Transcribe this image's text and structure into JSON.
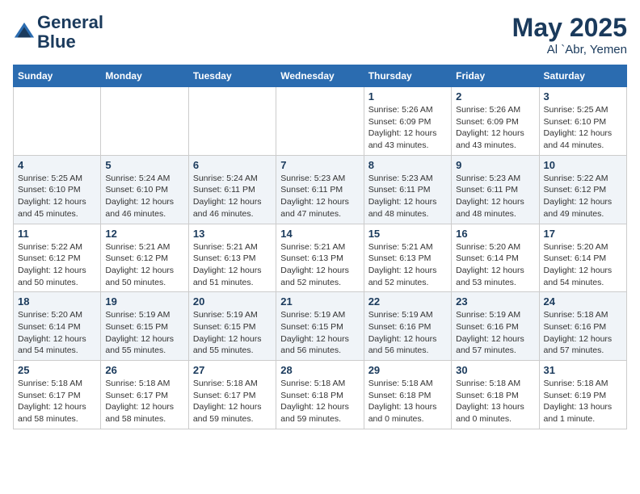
{
  "header": {
    "logo_line1": "General",
    "logo_line2": "Blue",
    "month_year": "May 2025",
    "location": "Al `Abr, Yemen"
  },
  "days_of_week": [
    "Sunday",
    "Monday",
    "Tuesday",
    "Wednesday",
    "Thursday",
    "Friday",
    "Saturday"
  ],
  "weeks": [
    [
      {
        "day": "",
        "info": ""
      },
      {
        "day": "",
        "info": ""
      },
      {
        "day": "",
        "info": ""
      },
      {
        "day": "",
        "info": ""
      },
      {
        "day": "1",
        "info": "Sunrise: 5:26 AM\nSunset: 6:09 PM\nDaylight: 12 hours\nand 43 minutes."
      },
      {
        "day": "2",
        "info": "Sunrise: 5:26 AM\nSunset: 6:09 PM\nDaylight: 12 hours\nand 43 minutes."
      },
      {
        "day": "3",
        "info": "Sunrise: 5:25 AM\nSunset: 6:10 PM\nDaylight: 12 hours\nand 44 minutes."
      }
    ],
    [
      {
        "day": "4",
        "info": "Sunrise: 5:25 AM\nSunset: 6:10 PM\nDaylight: 12 hours\nand 45 minutes."
      },
      {
        "day": "5",
        "info": "Sunrise: 5:24 AM\nSunset: 6:10 PM\nDaylight: 12 hours\nand 46 minutes."
      },
      {
        "day": "6",
        "info": "Sunrise: 5:24 AM\nSunset: 6:11 PM\nDaylight: 12 hours\nand 46 minutes."
      },
      {
        "day": "7",
        "info": "Sunrise: 5:23 AM\nSunset: 6:11 PM\nDaylight: 12 hours\nand 47 minutes."
      },
      {
        "day": "8",
        "info": "Sunrise: 5:23 AM\nSunset: 6:11 PM\nDaylight: 12 hours\nand 48 minutes."
      },
      {
        "day": "9",
        "info": "Sunrise: 5:23 AM\nSunset: 6:11 PM\nDaylight: 12 hours\nand 48 minutes."
      },
      {
        "day": "10",
        "info": "Sunrise: 5:22 AM\nSunset: 6:12 PM\nDaylight: 12 hours\nand 49 minutes."
      }
    ],
    [
      {
        "day": "11",
        "info": "Sunrise: 5:22 AM\nSunset: 6:12 PM\nDaylight: 12 hours\nand 50 minutes."
      },
      {
        "day": "12",
        "info": "Sunrise: 5:21 AM\nSunset: 6:12 PM\nDaylight: 12 hours\nand 50 minutes."
      },
      {
        "day": "13",
        "info": "Sunrise: 5:21 AM\nSunset: 6:13 PM\nDaylight: 12 hours\nand 51 minutes."
      },
      {
        "day": "14",
        "info": "Sunrise: 5:21 AM\nSunset: 6:13 PM\nDaylight: 12 hours\nand 52 minutes."
      },
      {
        "day": "15",
        "info": "Sunrise: 5:21 AM\nSunset: 6:13 PM\nDaylight: 12 hours\nand 52 minutes."
      },
      {
        "day": "16",
        "info": "Sunrise: 5:20 AM\nSunset: 6:14 PM\nDaylight: 12 hours\nand 53 minutes."
      },
      {
        "day": "17",
        "info": "Sunrise: 5:20 AM\nSunset: 6:14 PM\nDaylight: 12 hours\nand 54 minutes."
      }
    ],
    [
      {
        "day": "18",
        "info": "Sunrise: 5:20 AM\nSunset: 6:14 PM\nDaylight: 12 hours\nand 54 minutes."
      },
      {
        "day": "19",
        "info": "Sunrise: 5:19 AM\nSunset: 6:15 PM\nDaylight: 12 hours\nand 55 minutes."
      },
      {
        "day": "20",
        "info": "Sunrise: 5:19 AM\nSunset: 6:15 PM\nDaylight: 12 hours\nand 55 minutes."
      },
      {
        "day": "21",
        "info": "Sunrise: 5:19 AM\nSunset: 6:15 PM\nDaylight: 12 hours\nand 56 minutes."
      },
      {
        "day": "22",
        "info": "Sunrise: 5:19 AM\nSunset: 6:16 PM\nDaylight: 12 hours\nand 56 minutes."
      },
      {
        "day": "23",
        "info": "Sunrise: 5:19 AM\nSunset: 6:16 PM\nDaylight: 12 hours\nand 57 minutes."
      },
      {
        "day": "24",
        "info": "Sunrise: 5:18 AM\nSunset: 6:16 PM\nDaylight: 12 hours\nand 57 minutes."
      }
    ],
    [
      {
        "day": "25",
        "info": "Sunrise: 5:18 AM\nSunset: 6:17 PM\nDaylight: 12 hours\nand 58 minutes."
      },
      {
        "day": "26",
        "info": "Sunrise: 5:18 AM\nSunset: 6:17 PM\nDaylight: 12 hours\nand 58 minutes."
      },
      {
        "day": "27",
        "info": "Sunrise: 5:18 AM\nSunset: 6:17 PM\nDaylight: 12 hours\nand 59 minutes."
      },
      {
        "day": "28",
        "info": "Sunrise: 5:18 AM\nSunset: 6:18 PM\nDaylight: 12 hours\nand 59 minutes."
      },
      {
        "day": "29",
        "info": "Sunrise: 5:18 AM\nSunset: 6:18 PM\nDaylight: 13 hours\nand 0 minutes."
      },
      {
        "day": "30",
        "info": "Sunrise: 5:18 AM\nSunset: 6:18 PM\nDaylight: 13 hours\nand 0 minutes."
      },
      {
        "day": "31",
        "info": "Sunrise: 5:18 AM\nSunset: 6:19 PM\nDaylight: 13 hours\nand 1 minute."
      }
    ]
  ]
}
